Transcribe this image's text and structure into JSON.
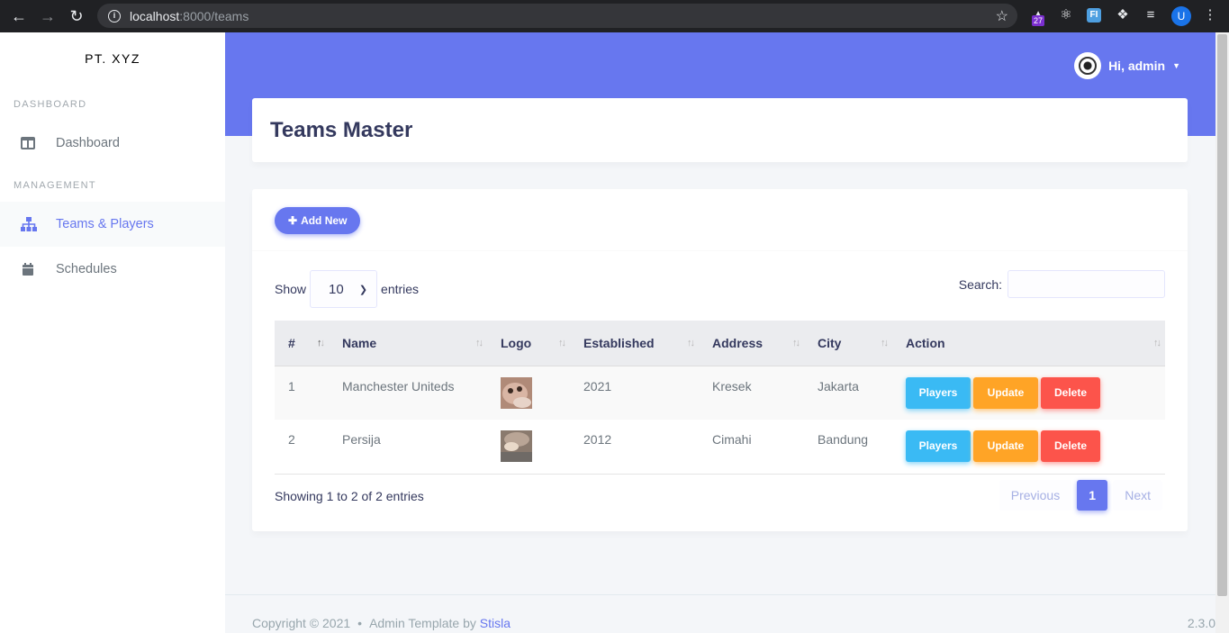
{
  "browser": {
    "url_host": "localhost",
    "url_rest": ":8000/teams",
    "ext_badge": "27",
    "ext_fi": "FI",
    "profile_initial": "U"
  },
  "sidebar": {
    "brand": "PT. XYZ",
    "sections": [
      {
        "header": "DASHBOARD",
        "items": [
          {
            "label": "Dashboard",
            "icon": "columns-icon"
          }
        ]
      },
      {
        "header": "MANAGEMENT",
        "items": [
          {
            "label": "Teams & Players",
            "icon": "sitemap-icon",
            "active": true
          },
          {
            "label": "Schedules",
            "icon": "calendar-icon"
          }
        ]
      }
    ]
  },
  "header": {
    "user_greeting": "Hi, admin"
  },
  "page": {
    "title": "Teams Master"
  },
  "toolbar": {
    "add_label": "Add New"
  },
  "datatable": {
    "show_label": "Show",
    "entries_label": "entries",
    "page_size": "10",
    "search_label": "Search:",
    "columns": [
      "#",
      "Name",
      "Logo",
      "Established",
      "Address",
      "City",
      "Action"
    ],
    "rows": [
      {
        "no": "1",
        "name": "Manchester Uniteds",
        "established": "2021",
        "address": "Kresek",
        "city": "Jakarta"
      },
      {
        "no": "2",
        "name": "Persija",
        "established": "2012",
        "address": "Cimahi",
        "city": "Bandung"
      }
    ],
    "action_labels": {
      "players": "Players",
      "update": "Update",
      "delete": "Delete"
    },
    "info": "Showing 1 to 2 of 2 entries",
    "pagination": {
      "previous": "Previous",
      "current": "1",
      "next": "Next"
    }
  },
  "footer": {
    "copyright": "Copyright © 2021",
    "template_by": "Admin Template by",
    "template_link": "Stisla",
    "version": "2.3.0"
  },
  "colors": {
    "primary": "#6777ef",
    "info": "#3abaf4",
    "warning": "#ffa426",
    "danger": "#fc544b"
  }
}
